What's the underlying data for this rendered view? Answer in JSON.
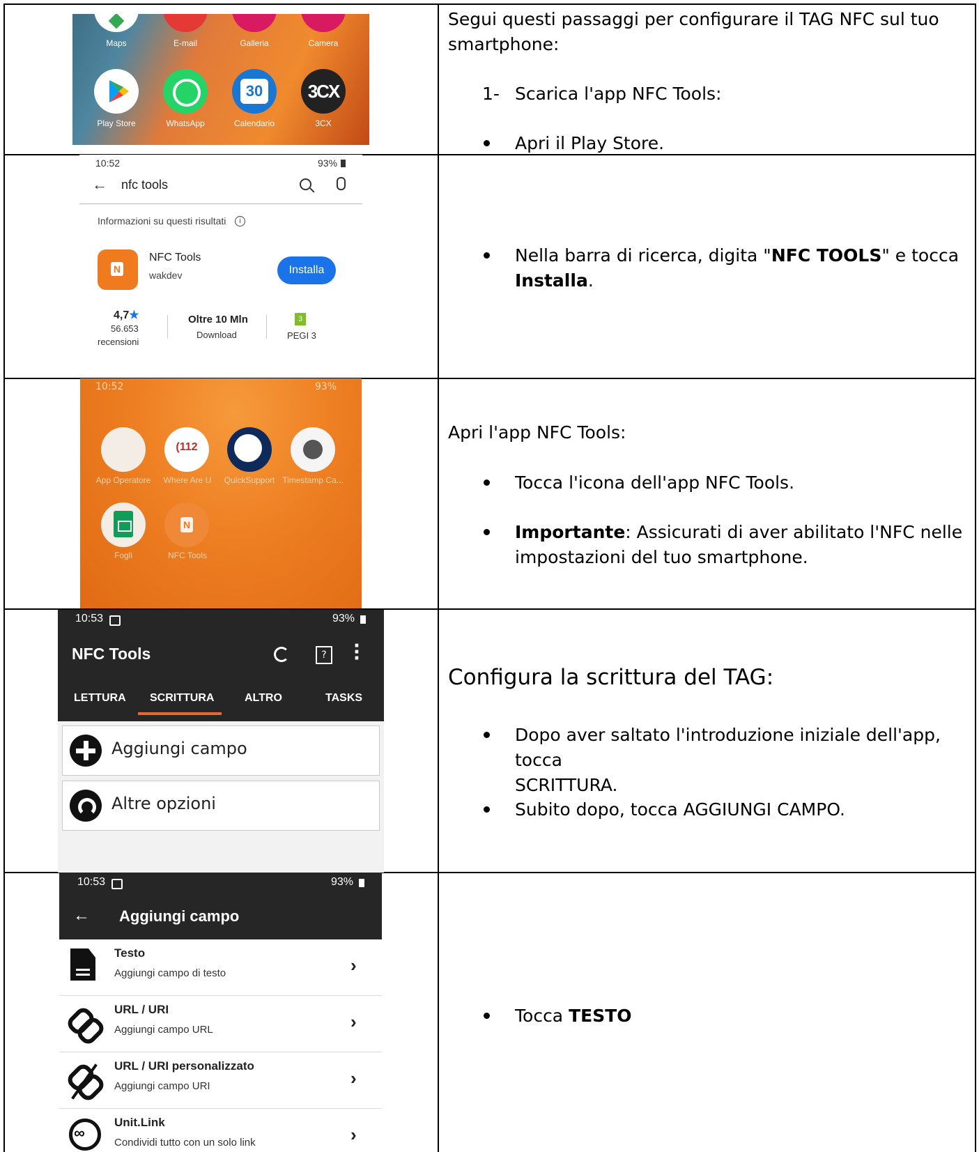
{
  "row1": {
    "intro": "Segui questi passaggi per configurare il TAG NFC sul tuo smartphone:",
    "step_number": "1-",
    "step_text": "Scarica l'app NFC Tools:",
    "bullet": "Apri il Play Store.",
    "screenshot": {
      "top_labels": [
        "Maps",
        "E-mail",
        "Galleria",
        "Camera"
      ],
      "apps": [
        {
          "label": "Play Store"
        },
        {
          "label": "WhatsApp"
        },
        {
          "label": "Calendario",
          "glyph": "30"
        },
        {
          "label": "3CX",
          "glyph": "3CX"
        }
      ]
    }
  },
  "row2": {
    "bullet_pre": "Nella barra di ricerca, digita \"",
    "bullet_bold1": "NFC TOOLS",
    "bullet_mid": "\" e tocca",
    "bullet_bold2": "Installa",
    "bullet_post": ".",
    "screenshot": {
      "time": "10:52",
      "battery": "93%",
      "query": "nfc tools",
      "info": "Informazioni su questi risultati",
      "app_name": "NFC Tools",
      "developer": "wakdev",
      "install": "Installa",
      "rating": "4,7",
      "reviews_count": "56.653",
      "reviews_label": "recensioni",
      "downloads": "Oltre 10 Mln",
      "downloads_label": "Download",
      "pegi_badge": "3",
      "pegi": "PEGI 3"
    }
  },
  "row3": {
    "heading": "Apri l'app NFC Tools:",
    "bullet1": "Tocca l'icona dell'app NFC Tools.",
    "bullet2_bold": "Importante",
    "bullet2_rest": ": Assicurati di aver abilitato l'NFC nelle",
    "bullet2_line2": "impostazioni del tuo smartphone.",
    "screenshot": {
      "time": "10:52",
      "battery": "93%",
      "apps": [
        "App Operatore",
        "Where Are U",
        "QuickSupport",
        "Timestamp Ca...",
        "Fogli",
        "NFC Tools"
      ],
      "where_glyph": "(112"
    }
  },
  "row4": {
    "heading": "Configura la scrittura del TAG:",
    "bullet1_line1": "Dopo aver saltato l'introduzione iniziale dell'app, tocca",
    "bullet1_line2": "SCRITTURA.",
    "bullet2": "Subito dopo, tocca AGGIUNGI CAMPO.",
    "screenshot": {
      "time": "10:53",
      "battery": "93%",
      "title": "NFC Tools",
      "tabs": [
        "LETTURA",
        "SCRITTURA",
        "ALTRO",
        "TASKS"
      ],
      "active_tab": "SCRITTURA",
      "option1": "Aggiungi campo",
      "option2": "Altre opzioni",
      "accent": "#e8692a"
    }
  },
  "row5": {
    "bullet_pre": "Tocca",
    "bullet_bold": "TESTO",
    "screenshot": {
      "time": "10:53",
      "battery": "93%",
      "title": "Aggiungi campo",
      "items": [
        {
          "title": "Testo",
          "subtitle": "Aggiungi campo di testo",
          "icon": "document-icon"
        },
        {
          "title": "URL / URI",
          "subtitle": "Aggiungi campo URL",
          "icon": "link-icon"
        },
        {
          "title": "URL / URI personalizzato",
          "subtitle": "Aggiungi campo URI",
          "icon": "broken-link-icon"
        },
        {
          "title": "Unit.Link",
          "subtitle": "Condividi tutto con un solo link",
          "icon": "unit-link-icon"
        }
      ]
    }
  }
}
